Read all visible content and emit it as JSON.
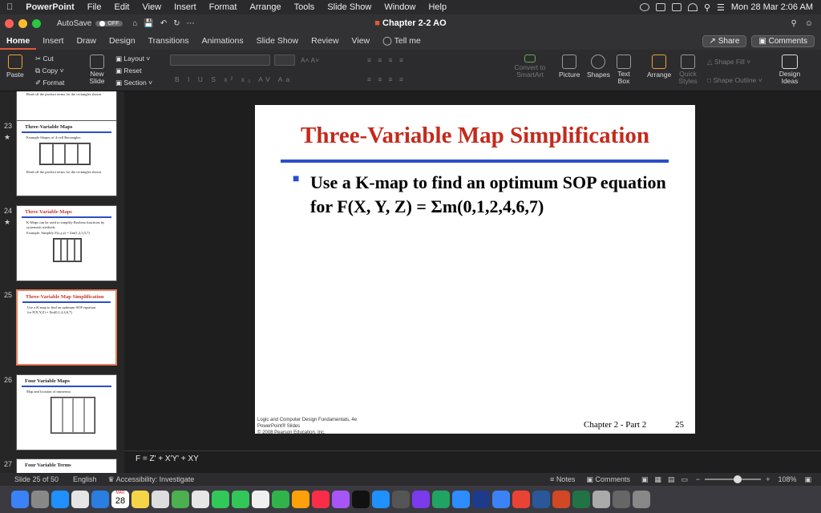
{
  "menubar": {
    "app": "PowerPoint",
    "items": [
      "File",
      "Edit",
      "View",
      "Insert",
      "Format",
      "Arrange",
      "Tools",
      "Slide Show",
      "Window",
      "Help"
    ],
    "clock": "Mon 28 Mar  2:06 AM"
  },
  "titlebar": {
    "autosave": "AutoSave",
    "autosave_state": "OFF",
    "doc_title": "Chapter 2-2 AO"
  },
  "tabs": {
    "items": [
      "Home",
      "Insert",
      "Draw",
      "Design",
      "Transitions",
      "Animations",
      "Slide Show",
      "Review",
      "View"
    ],
    "tell_me": "Tell me",
    "share": "Share",
    "comments": "Comments"
  },
  "ribbon": {
    "paste": "Paste",
    "cut": "Cut",
    "copy": "Copy",
    "format": "Format",
    "new_slide": "New\nSlide",
    "layout": "Layout",
    "reset": "Reset",
    "section": "Section",
    "convert": "Convert to SmartArt",
    "picture": "Picture",
    "shapes": "Shapes",
    "textbox": "Text Box",
    "arrange": "Arrange",
    "quick_styles": "Quick Styles",
    "shape_fill": "Shape Fill",
    "shape_outline": "Shape Outline",
    "design_ideas": "Design Ideas"
  },
  "thumbs": [
    {
      "num": "23",
      "title": "Three-Variable Maps",
      "lines": [
        "Example Shapes of 4-cell Rectangles:",
        "Read off the product terms for the rectangles shown"
      ]
    },
    {
      "num": "24",
      "title": "Three Variable Maps",
      "lines": [
        "K-Maps can be used to simplify Boolean functions by systematic methods.",
        "Example: Simplify F(x,y,z) = Σm(1,2,3,5,7)"
      ]
    },
    {
      "num": "25",
      "title": "Three-Variable Map Simplification",
      "lines": [
        "Use a K-map to find an optimum SOP equation for F(X,Y,Z) = Σm(0,1,2,4,6,7)"
      ]
    },
    {
      "num": "26",
      "title": "Four Variable Maps",
      "lines": [
        "Map and location of minterms:"
      ]
    },
    {
      "num": "27",
      "title": "Four Variable Terms",
      "lines": []
    }
  ],
  "slide": {
    "title": "Three-Variable Map Simplification",
    "bullet": "Use a K-map to find an optimum SOP equation for F(X, Y, Z) = Σm(0,1,2,4,6,7)",
    "footer_left": "Logic and Computer Design Fundamentals, 4e\nPowerPoint® Slides\n© 2008 Pearson Education, Inc.",
    "footer_mid": "Chapter 2 - Part 2",
    "footer_num": "25"
  },
  "notes": "F = Z' + X'Y' + XY",
  "status": {
    "slide": "Slide 25 of 50",
    "lang": "English",
    "access": "Accessibility: Investigate",
    "notes": "Notes",
    "comments": "Comments",
    "zoom": "108%"
  },
  "dock": {
    "calendar_day": "28",
    "calendar_month": "MAR"
  }
}
